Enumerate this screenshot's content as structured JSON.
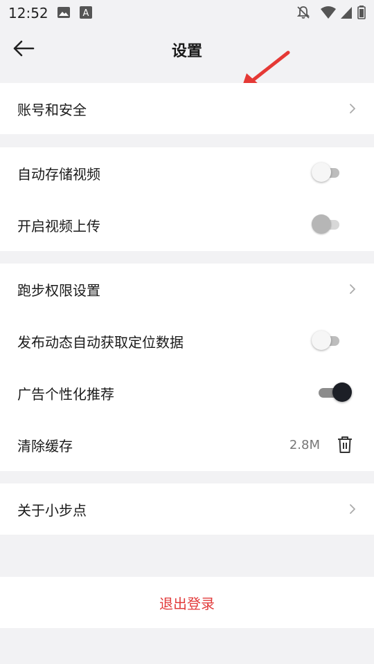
{
  "status_bar": {
    "time": "12:52",
    "icons": [
      "image-icon",
      "text-a-icon",
      "bell-off-icon",
      "wifi-icon",
      "signal-icon",
      "battery-icon"
    ]
  },
  "header": {
    "title": "设置"
  },
  "sections": {
    "account": {
      "label": "账号和安全"
    },
    "auto_save_video": {
      "label": "自动存储视频",
      "enabled": false
    },
    "video_upload": {
      "label": "开启视频上传",
      "enabled": false
    },
    "run_permission": {
      "label": "跑步权限设置"
    },
    "location_on_post": {
      "label": "发布动态自动获取定位数据",
      "enabled": false
    },
    "personalized_ads": {
      "label": "广告个性化推荐",
      "enabled": true
    },
    "clear_cache": {
      "label": "清除缓存",
      "value": "2.8M"
    },
    "about": {
      "label": "关于小步点"
    }
  },
  "logout": {
    "label": "退出登录"
  },
  "colors": {
    "background": "#f2f2f4",
    "card": "#ffffff",
    "logout_text": "#e23b3b",
    "annotation_arrow": "#e53935",
    "toggle_on_knob": "#1c1f26"
  }
}
